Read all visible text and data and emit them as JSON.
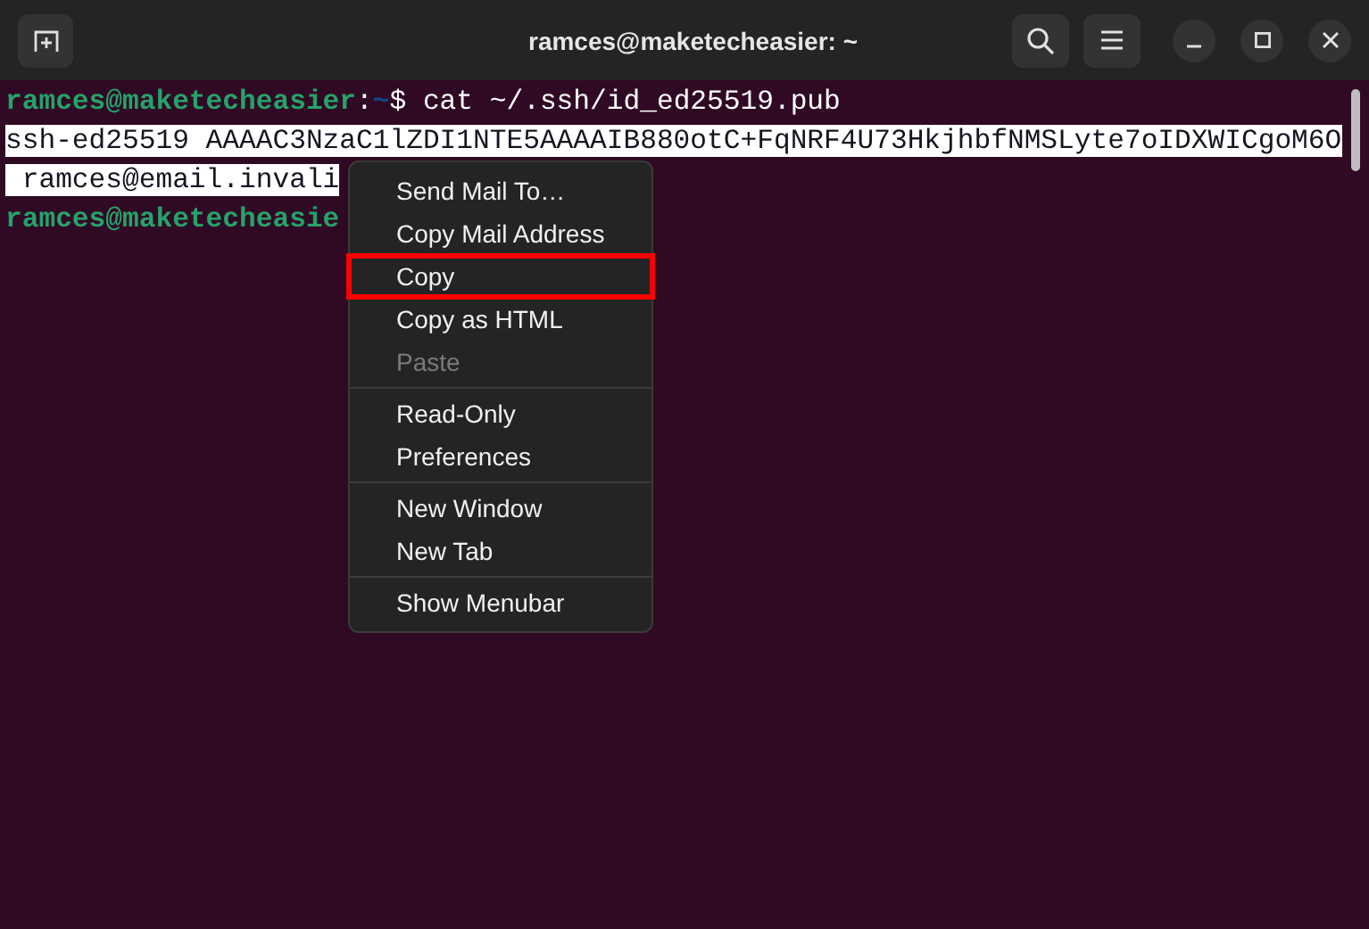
{
  "window": {
    "title": "ramces@maketecheasier: ~"
  },
  "terminal": {
    "lines": [
      {
        "kind": "prompt",
        "user": "ramces@maketecheasier",
        "sep": ":",
        "path": "~",
        "command": "$ cat ~/.ssh/id_ed25519.pub"
      },
      {
        "kind": "output",
        "selected": true,
        "text": "ssh-ed25519 AAAAC3NzaC1lZDI1NTE5AAAAIB880otC+FqNRF4U73HkjhbfNMSLyte7oIDXWICgoM6O"
      },
      {
        "kind": "output",
        "selected": true,
        "text": " ramces@email.invali"
      },
      {
        "kind": "prompt",
        "user": "ramces@maketecheasie"
      }
    ]
  },
  "context_menu": {
    "groups": [
      [
        {
          "label": "Send Mail To…",
          "disabled": false,
          "outlined": false
        },
        {
          "label": "Copy Mail Address",
          "disabled": false,
          "outlined": false
        },
        {
          "label": "Copy",
          "disabled": false,
          "outlined": true
        },
        {
          "label": "Copy as HTML",
          "disabled": false,
          "outlined": false
        },
        {
          "label": "Paste",
          "disabled": true,
          "outlined": false
        }
      ],
      [
        {
          "label": "Read-Only",
          "disabled": false,
          "outlined": false
        },
        {
          "label": "Preferences",
          "disabled": false,
          "outlined": false
        }
      ],
      [
        {
          "label": "New Window",
          "disabled": false,
          "outlined": false
        },
        {
          "label": "New Tab",
          "disabled": false,
          "outlined": false
        }
      ],
      [
        {
          "label": "Show Menubar",
          "disabled": false,
          "outlined": false
        }
      ]
    ]
  }
}
